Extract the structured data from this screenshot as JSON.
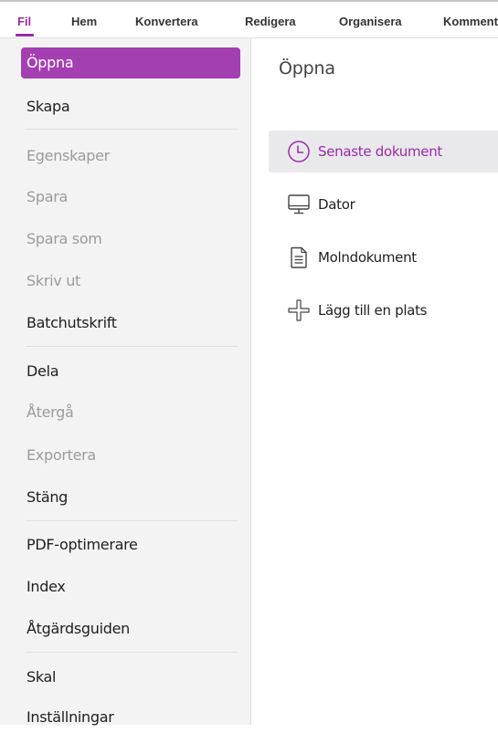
{
  "menubar": {
    "tabs": [
      {
        "label": "Fil",
        "active": true
      },
      {
        "label": "Hem"
      },
      {
        "label": "Konvertera"
      },
      {
        "label": "Redigera"
      },
      {
        "label": "Organisera"
      },
      {
        "label": "Kommentar"
      }
    ]
  },
  "sidebar": {
    "items": [
      {
        "label": "Öppna",
        "state": "selected"
      },
      {
        "label": "Skapa",
        "state": "enabled"
      },
      {
        "label": "Egenskaper",
        "state": "disabled"
      },
      {
        "label": "Spara",
        "state": "disabled"
      },
      {
        "label": "Spara som",
        "state": "disabled"
      },
      {
        "label": "Skriv ut",
        "state": "disabled"
      },
      {
        "label": "Batchutskrift",
        "state": "enabled"
      },
      {
        "label": "Dela",
        "state": "enabled"
      },
      {
        "label": "Återgå",
        "state": "disabled"
      },
      {
        "label": "Exportera",
        "state": "disabled"
      },
      {
        "label": "Stäng",
        "state": "enabled"
      },
      {
        "label": "PDF-optimerare",
        "state": "enabled"
      },
      {
        "label": "Index",
        "state": "enabled"
      },
      {
        "label": "Åtgärdsguiden",
        "state": "enabled"
      },
      {
        "label": "Skal",
        "state": "enabled"
      },
      {
        "label": "Inställningar",
        "state": "enabled"
      }
    ]
  },
  "main": {
    "title": "Öppna",
    "locations": [
      {
        "label": "Senaste dokument",
        "icon": "clock-icon",
        "selected": true
      },
      {
        "label": "Dator",
        "icon": "monitor-icon"
      },
      {
        "label": "Molndokument",
        "icon": "document-icon"
      },
      {
        "label": "Lägg till en plats",
        "icon": "plus-icon"
      }
    ]
  },
  "colors": {
    "accent": "#9b2aa6",
    "selected_bg": "#a43fb2",
    "sidebar_bg": "#f3f3f3",
    "disabled_text": "#9b9b9b"
  }
}
